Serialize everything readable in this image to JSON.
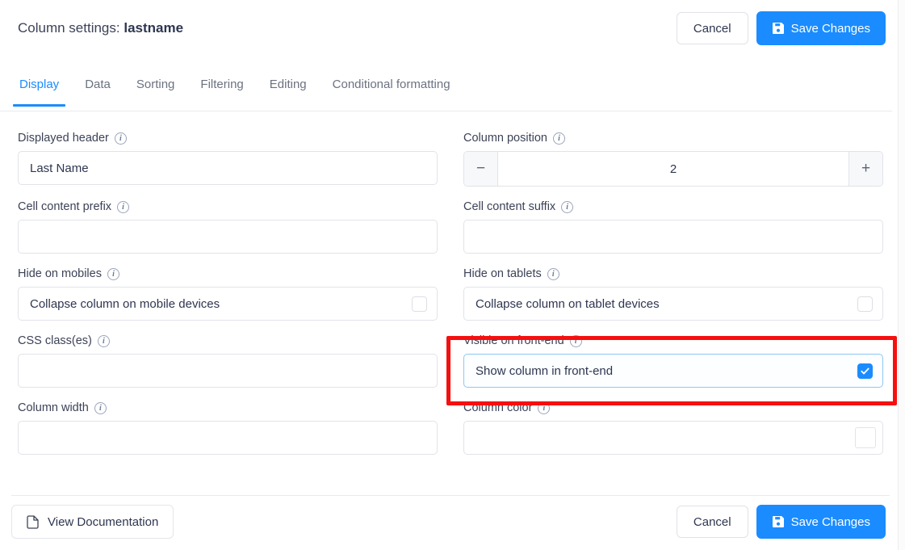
{
  "header": {
    "title_prefix": "Column settings:",
    "title_value": "lastname",
    "cancel_label": "Cancel",
    "save_label": "Save Changes",
    "save_icon": "save-floppy-icon"
  },
  "tabs": [
    {
      "label": "Display",
      "active": true
    },
    {
      "label": "Data",
      "active": false
    },
    {
      "label": "Sorting",
      "active": false
    },
    {
      "label": "Filtering",
      "active": false
    },
    {
      "label": "Editing",
      "active": false
    },
    {
      "label": "Conditional formatting",
      "active": false
    }
  ],
  "fields": {
    "displayed_header": {
      "label": "Displayed header",
      "value": "Last Name",
      "placeholder": "",
      "info_icon": "info-icon"
    },
    "column_position": {
      "label": "Column position",
      "value": "2",
      "minus_label": "−",
      "plus_label": "+",
      "info_icon": "info-icon"
    },
    "cell_content_prefix": {
      "label": "Cell content prefix",
      "value": "",
      "placeholder": "",
      "info_icon": "info-icon"
    },
    "cell_content_suffix": {
      "label": "Cell content suffix",
      "value": "",
      "placeholder": "",
      "info_icon": "info-icon"
    },
    "hide_on_mobiles": {
      "label": "Hide on mobiles",
      "option_label": "Collapse column on mobile devices",
      "checked": false,
      "info_icon": "info-icon"
    },
    "hide_on_tablets": {
      "label": "Hide on tablets",
      "option_label": "Collapse column on tablet devices",
      "checked": false,
      "info_icon": "info-icon"
    },
    "css_classes": {
      "label": "CSS class(es)",
      "value": "",
      "placeholder": "",
      "info_icon": "info-icon"
    },
    "visible_on_frontend": {
      "label": "Visible on front-end",
      "option_label": "Show column in front-end",
      "checked": true,
      "highlighted": true,
      "info_icon": "info-icon"
    },
    "column_width": {
      "label": "Column width",
      "value": "",
      "placeholder": "",
      "info_icon": "info-icon"
    },
    "column_color": {
      "label": "Column color",
      "value": "",
      "placeholder": "",
      "swatch_color": "#ffffff",
      "info_icon": "info-icon"
    }
  },
  "footer": {
    "documentation_label": "View Documentation",
    "documentation_icon": "document-icon",
    "cancel_label": "Cancel",
    "save_label": "Save Changes",
    "save_icon": "save-floppy-icon"
  },
  "colors": {
    "accent": "#1a8cff",
    "highlight_box": "#f60f0f",
    "text": "#2e3650",
    "muted_text": "#6b7280",
    "border": "#e1e3ea"
  },
  "info_glyph": "i"
}
